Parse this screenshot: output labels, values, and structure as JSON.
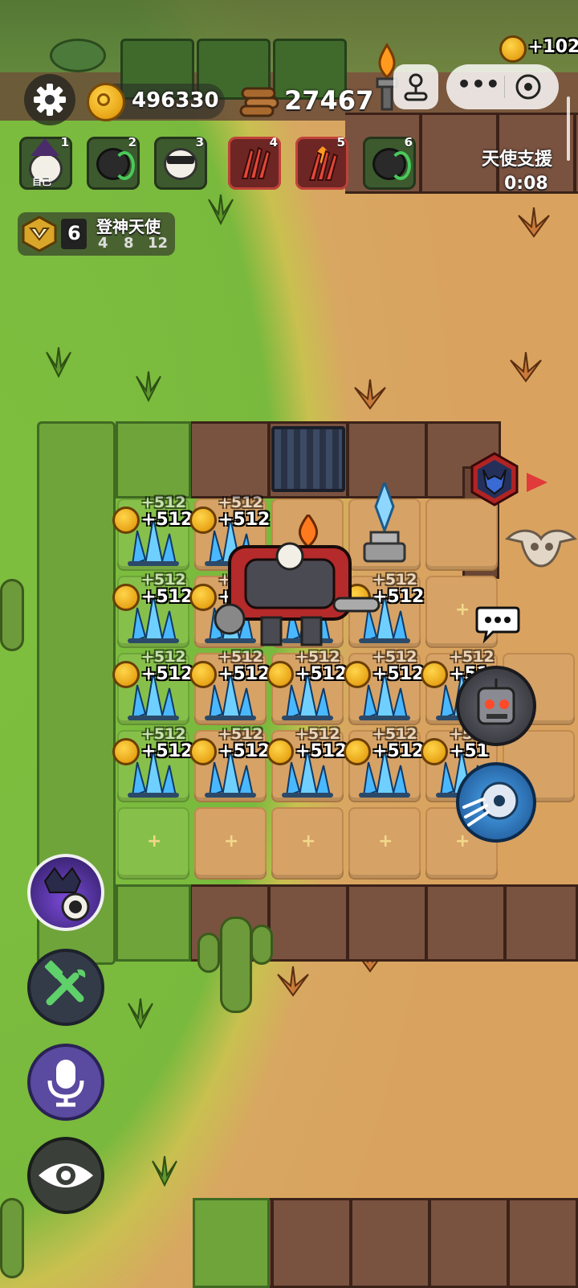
{
  "hud": {
    "gold": "496330",
    "wood": "27467",
    "top_right_gold": "+102",
    "event_title": "天使支援",
    "event_timer": "0:08"
  },
  "players": [
    {
      "num": "1",
      "tag": "自己",
      "icon": "wizard-sheep-avatar-icon",
      "style": "normal"
    },
    {
      "num": "2",
      "icon": "dark-sheep-green-ring-avatar-icon",
      "style": "normal"
    },
    {
      "num": "3",
      "icon": "sheep-mask-avatar-icon",
      "style": "normal"
    },
    {
      "num": "4",
      "icon": "red-claw-avatar-icon",
      "style": "red"
    },
    {
      "num": "5",
      "icon": "red-fire-claw-avatar-icon",
      "style": "red"
    },
    {
      "num": "6",
      "icon": "dark-sheep-green-ring-avatar-icon",
      "style": "normal"
    }
  ],
  "synergy": {
    "count": "6",
    "name": "登神天使",
    "tiers": [
      "4",
      "8",
      "12"
    ]
  },
  "board": {
    "gain_label": "+512",
    "gain_label_cut": "+51"
  },
  "colors": {
    "grass": "#79b93d",
    "sand": "#d9a35f",
    "wall": "#6a4533",
    "gold": "#e8a417"
  }
}
